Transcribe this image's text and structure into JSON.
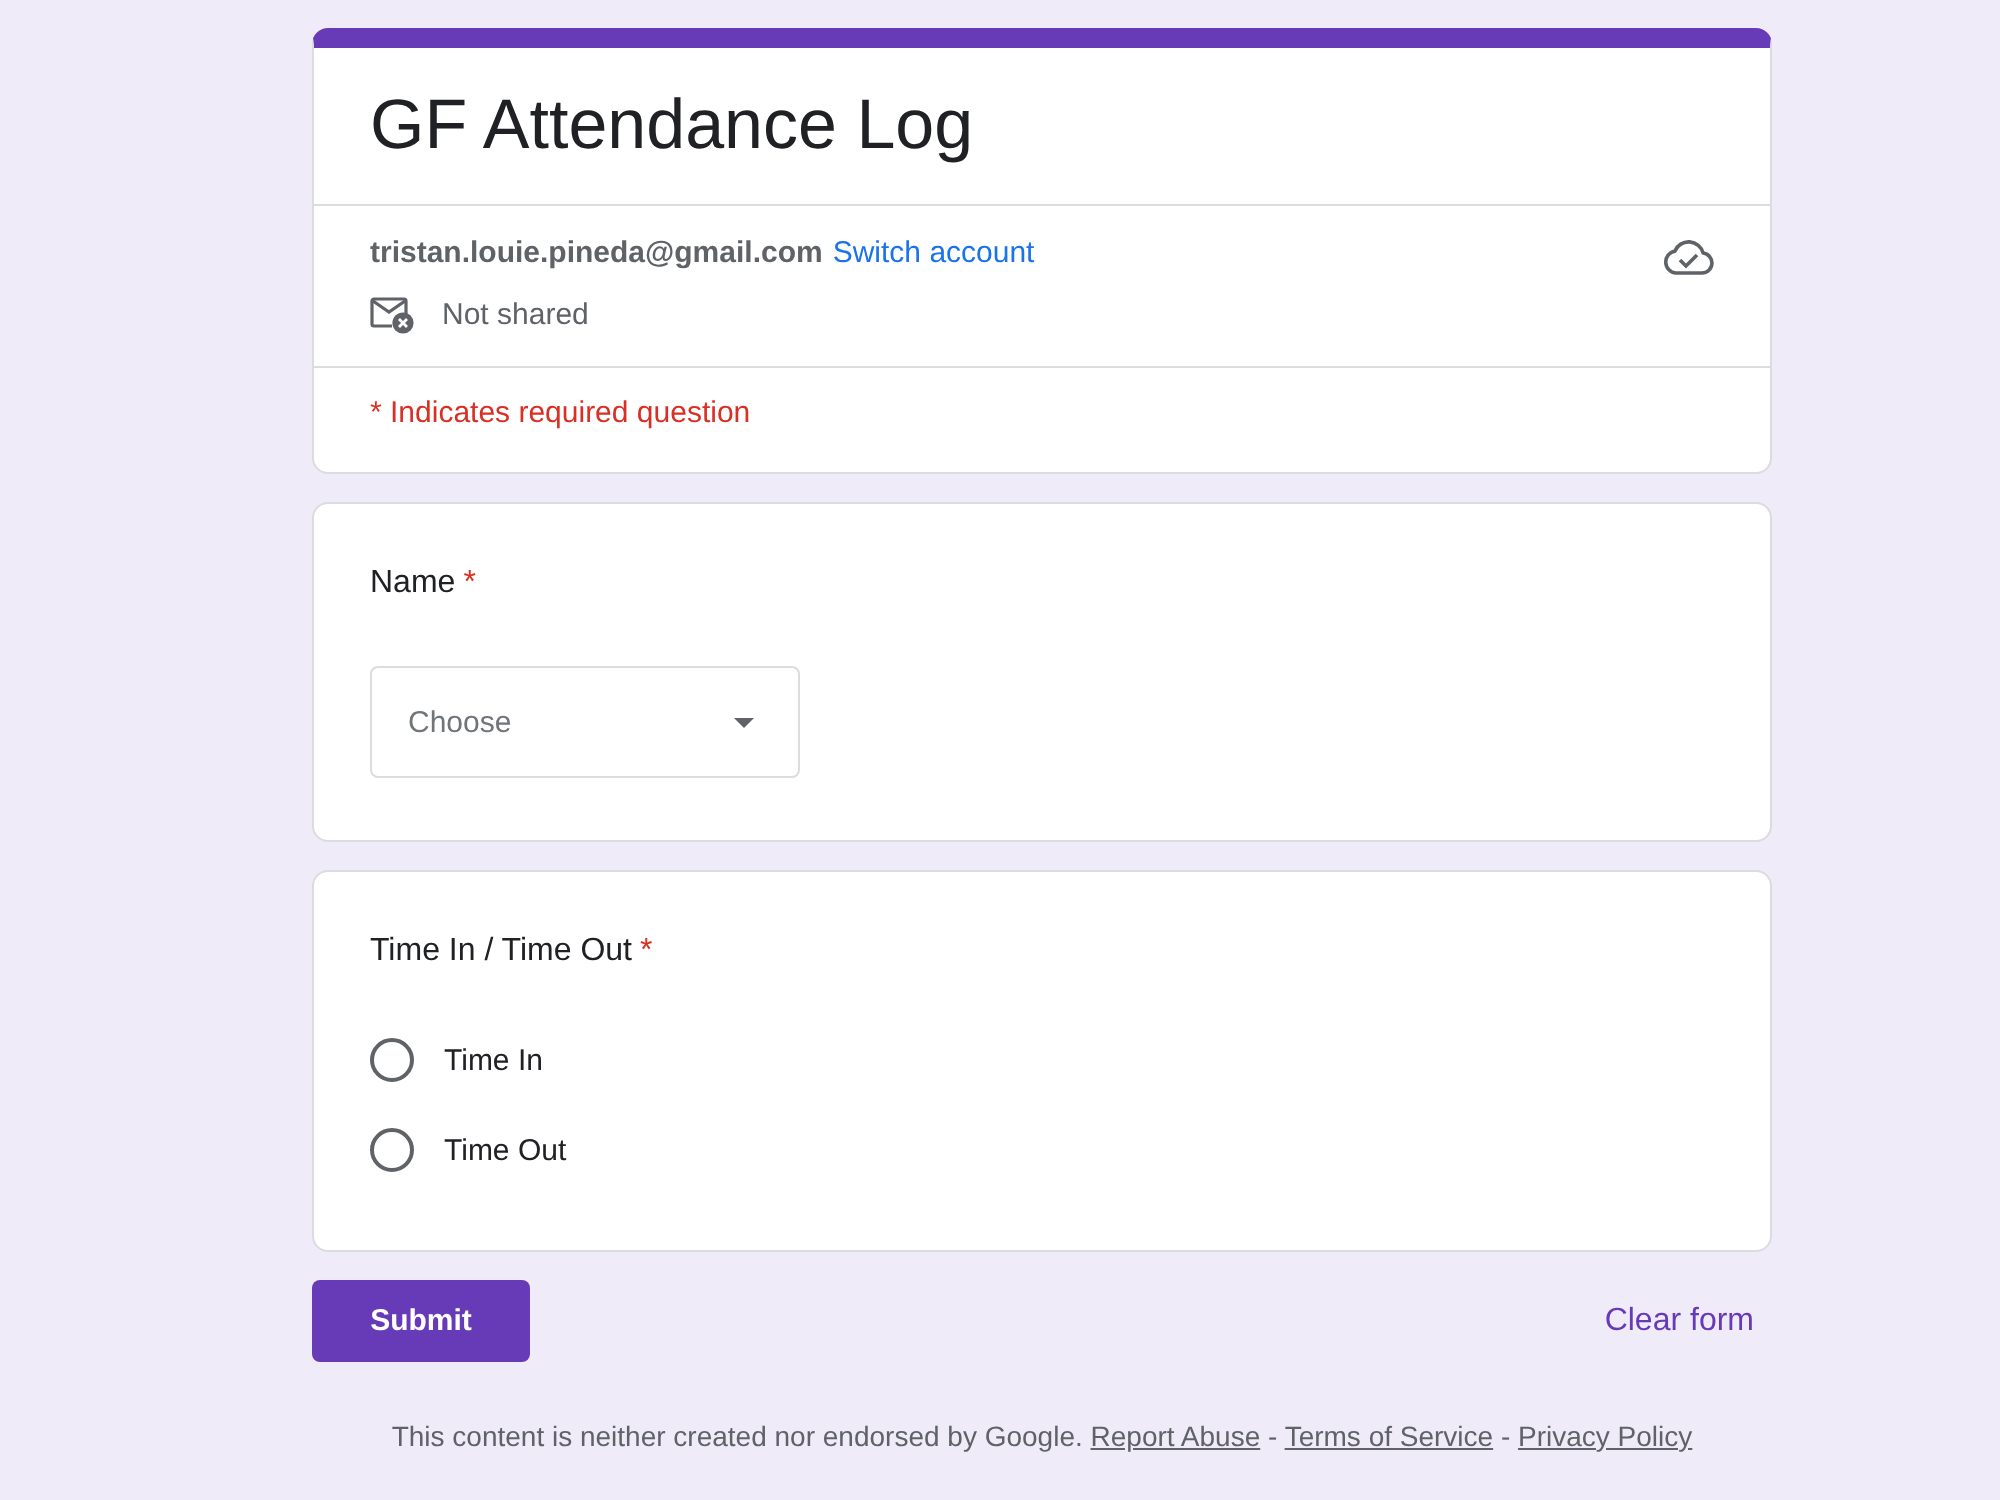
{
  "header": {
    "title": "GF Attendance Log",
    "account_email": "tristan.louie.pineda@gmail.com",
    "switch_account": "Switch account",
    "sharing_status": "Not shared",
    "required_note": "* Indicates required question"
  },
  "questions": [
    {
      "kind": "dropdown",
      "label": "Name",
      "required": true,
      "required_mark": "*",
      "placeholder": "Choose"
    },
    {
      "kind": "radio",
      "label": "Time In / Time Out",
      "required": true,
      "required_mark": "*",
      "options": [
        {
          "label": "Time In",
          "selected": false
        },
        {
          "label": "Time Out",
          "selected": false
        }
      ]
    }
  ],
  "actions": {
    "submit": "Submit",
    "clear": "Clear form"
  },
  "footer": {
    "parts": [
      {
        "kind": "text",
        "text": "This content is neither created nor endorsed by Google."
      },
      {
        "kind": "link",
        "text": "Report Abuse"
      },
      {
        "kind": "separator",
        "text": "-"
      },
      {
        "kind": "link",
        "text": "Terms of Service"
      },
      {
        "kind": "separator",
        "text": "-"
      },
      {
        "kind": "link",
        "text": "Privacy Policy"
      }
    ]
  }
}
